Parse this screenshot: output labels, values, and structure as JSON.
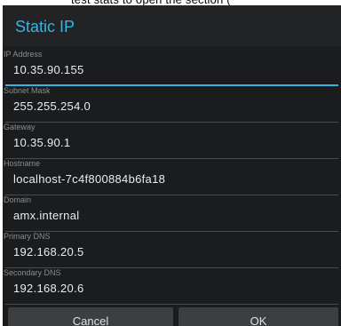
{
  "dialog": {
    "title": "Static IP",
    "fields": [
      {
        "label": "IP Address",
        "value": "10.35.90.155"
      },
      {
        "label": "Subnet Mask",
        "value": "255.255.254.0"
      },
      {
        "label": "Gateway",
        "value": "10.35.90.1"
      },
      {
        "label": "Hostname",
        "value": "localhost-7c4f800884b6fa18"
      },
      {
        "label": "Domain",
        "value": "amx.internal"
      },
      {
        "label": "Primary DNS",
        "value": "192.168.20.5"
      },
      {
        "label": "Secondary DNS",
        "value": "192.168.20.6"
      }
    ],
    "buttons": {
      "cancel": "Cancel",
      "ok": "OK"
    }
  },
  "colors": {
    "accent": "#33b5e5",
    "dialog_background": "#1a1c1d",
    "button_background": "#3c3e40"
  }
}
